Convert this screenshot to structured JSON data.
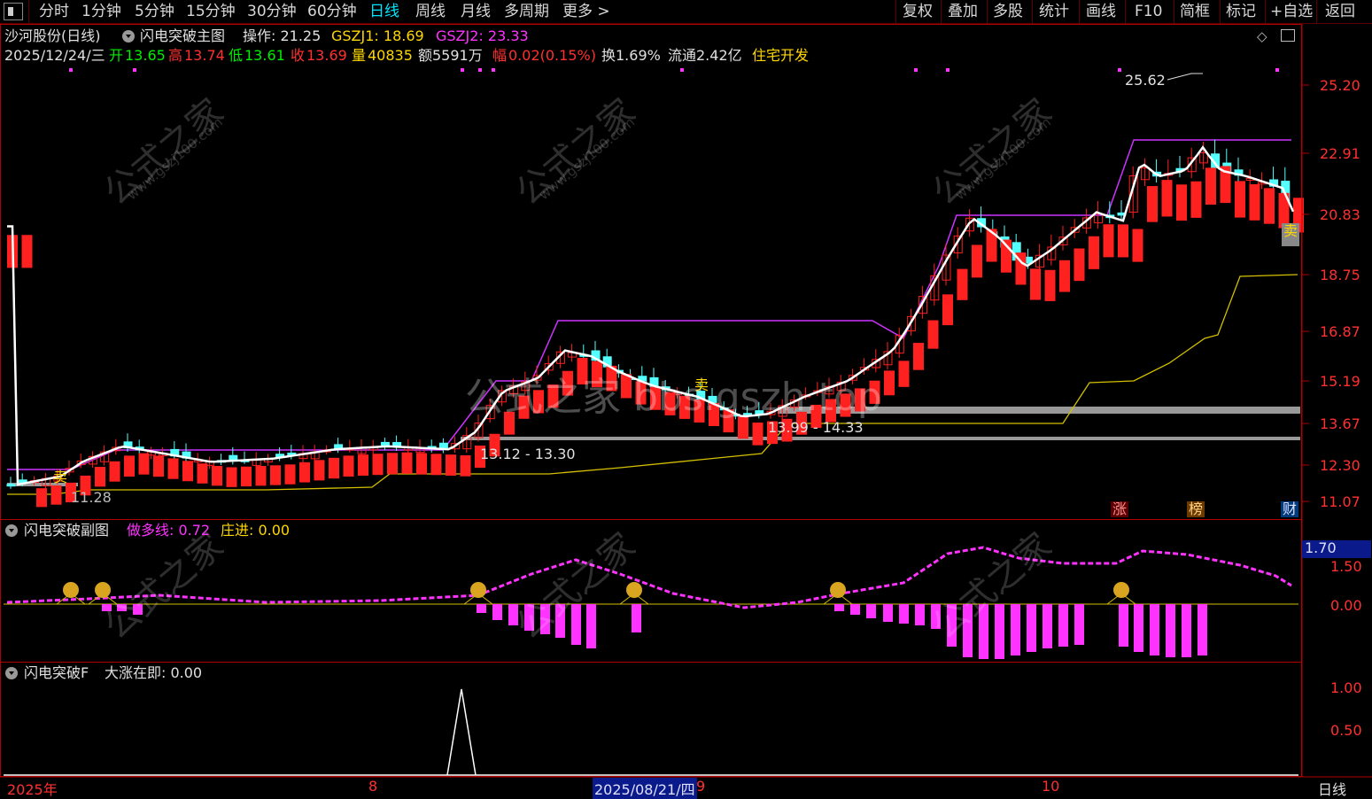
{
  "toolbar": {
    "periods": [
      "分时",
      "1分钟",
      "5分钟",
      "15分钟",
      "30分钟",
      "60分钟",
      "日线",
      "周线",
      "月线",
      "多周期",
      "更多 >"
    ],
    "active_period": "日线",
    "actions": [
      "复权",
      "叠加",
      "多股",
      "统计",
      "画线",
      "F10",
      "简框",
      "标记",
      "+自选",
      "返回"
    ]
  },
  "main_panel": {
    "stock_name": "沙河股份(日线)",
    "indicator_name": "闪电突破主图",
    "op_label": "操作: 21.25",
    "gszj1": "GSZJ1: 18.69",
    "gszj2": "GSZJ2: 23.33",
    "info": {
      "date": "2025/12/24/三",
      "open_label": "开",
      "open": "13.65",
      "high_label": "高",
      "high": "13.74",
      "low_label": "低",
      "low": "13.61",
      "close_label": "收",
      "close": "13.69",
      "volume_label": "量",
      "volume": "40835",
      "amount": "额5591万",
      "change_label": "幅",
      "change": "0.02(0.15%)",
      "turnover": "换1.69%",
      "float": "流通2.42亿",
      "sector": "住宅开发"
    },
    "annotations": {
      "peak": "25.62",
      "low_mark": "11.28",
      "range1": "13.12 - 13.30",
      "range2": "13.99 - 14.33",
      "sell1": "卖",
      "sell2": "卖",
      "sell3": "卖"
    },
    "price_axis": [
      "25.20",
      "22.91",
      "20.83",
      "18.75",
      "16.87",
      "15.19",
      "13.67",
      "12.30",
      "11.07"
    ],
    "badges": [
      "涨",
      "榜",
      "财"
    ],
    "watermark_center": "公式之家 bbs.gszh.top",
    "watermark_brand": "公式之家",
    "watermark_url": "www.gszj100.com"
  },
  "sub_panel": {
    "indicator_name": "闪电突破副图",
    "line_label": "做多线: 0.72",
    "zhuang_label": "庄进: 0.00",
    "axis": [
      "1.70",
      "1.50",
      "0.00"
    ],
    "current_value": "1.70"
  },
  "f_panel": {
    "indicator_name": "闪电突破F",
    "label": "大涨在即: 0.00",
    "axis": [
      "1.00",
      "0.50"
    ]
  },
  "date_axis": {
    "labels": [
      "2025年",
      "8",
      "2025/08/21/四",
      "9",
      "10"
    ],
    "period": "日线"
  },
  "colors": {
    "up": "#ff2020",
    "down": "#54ffff",
    "ma": "#ffffff",
    "purple": "#cc33ff",
    "yellow": "#d4c000",
    "magenta": "#ff33ff",
    "axis": "#ff3030",
    "highlight": "#00e5ff"
  }
}
